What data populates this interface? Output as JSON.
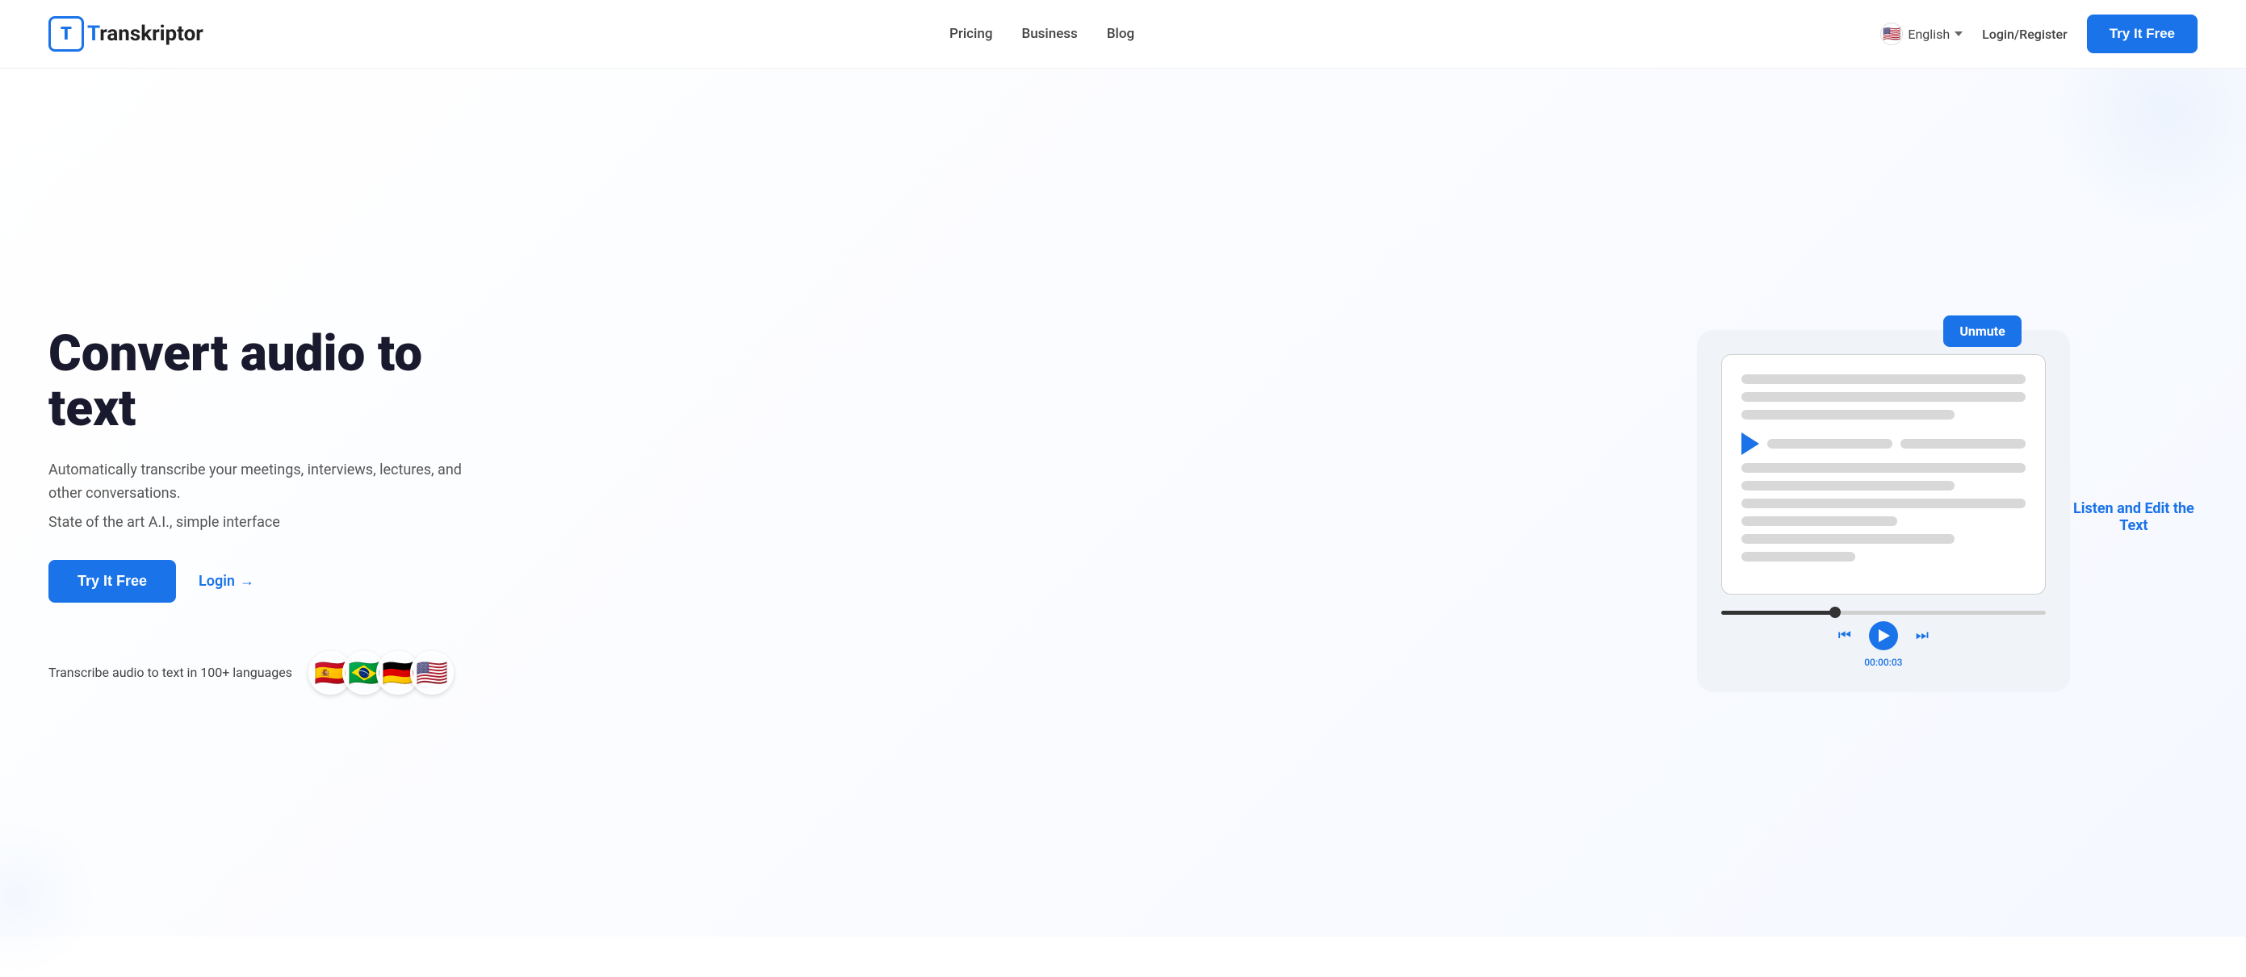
{
  "logo": {
    "icon_letter": "T",
    "text_prefix": "ranskriptor"
  },
  "navbar": {
    "links": [
      {
        "label": "Pricing",
        "href": "#"
      },
      {
        "label": "Business",
        "href": "#"
      },
      {
        "label": "Blog",
        "href": "#"
      }
    ],
    "language": {
      "label": "English",
      "flag_emoji": "🇺🇸"
    },
    "login_label": "Login/Register",
    "try_free_label": "Try It Free"
  },
  "hero": {
    "title": "Convert audio to text",
    "subtitle": "Automatically transcribe your meetings, interviews, lectures, and other conversations.",
    "subtitle2": "State of the art A.I., simple interface",
    "try_free_label": "Try It Free",
    "login_label": "Login",
    "login_arrow": "→",
    "languages_text": "Transcribe audio to text in 100+ languages",
    "flags": [
      "🇪🇸",
      "🇧🇷",
      "🇩🇪",
      "🇺🇸"
    ]
  },
  "illustration": {
    "unmute_label": "Unmute",
    "timestamp": "00:00:03",
    "edit_caption": "Listen and Edit the Text"
  }
}
